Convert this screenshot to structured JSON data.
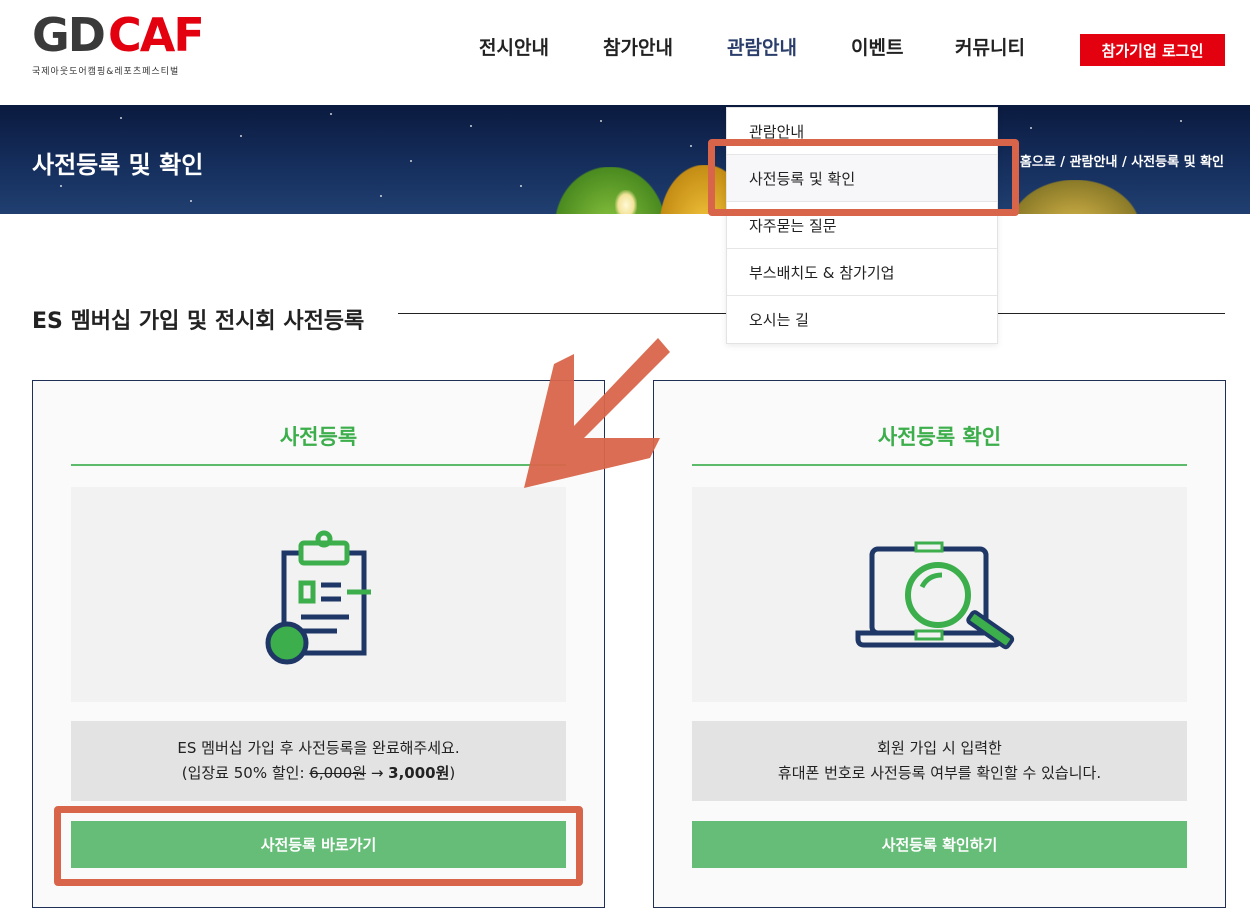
{
  "header": {
    "logo_text_g": "G",
    "logo_text_d": "D",
    "logo_text_caf": "CAF",
    "logo_subtitle": "국제아웃도어캠핑&레포츠페스티벌",
    "nav": [
      "전시안내",
      "참가안내",
      "관람안내",
      "이벤트",
      "커뮤니티"
    ],
    "active_nav": "관람안내",
    "login_label": "참가기업 로그인",
    "colors": {
      "login_bg": "#e3000f",
      "active_nav": "#2b3e6b"
    }
  },
  "banner": {
    "title": "사전등록 및 확인",
    "breadcrumb": "홈으로 / 관람안내 / 사전등록 및 확인"
  },
  "dropdown": {
    "items": [
      "관람안내",
      "사전등록 및 확인",
      "자주묻는 질문",
      "부스배치도 & 참가기업",
      "오시는 길"
    ],
    "highlighted": "사전등록 및 확인"
  },
  "section": {
    "title": "ES 멤버십 가입 및 전시회 사전등록"
  },
  "cards": {
    "register": {
      "title": "사전등록",
      "icon": "clipboard-icon",
      "desc_line1": "ES 멤버십 가입 후 사전등록을 완료해주세요.",
      "desc_line2_prefix": "(입장료 50% 할인: ",
      "desc_old_price": "6,000원",
      "desc_arrow": " → ",
      "desc_new_price": "3,000원",
      "desc_suffix": ")",
      "button": "사전등록 바로가기"
    },
    "check": {
      "title": "사전등록 확인",
      "icon": "laptop-search-icon",
      "desc_line1": "회원 가입 시 입력한",
      "desc_line2": "휴대폰 번호로 사전등록 여부를 확인할 수 있습니다.",
      "button": "사전등록 확인하기"
    },
    "colors": {
      "accent_green": "#3cae4b",
      "button_green": "#66bd78",
      "card_border": "#1f2f55",
      "icon_navy": "#1f3766"
    }
  },
  "annotations": {
    "highlight_color": "#d8654a"
  }
}
